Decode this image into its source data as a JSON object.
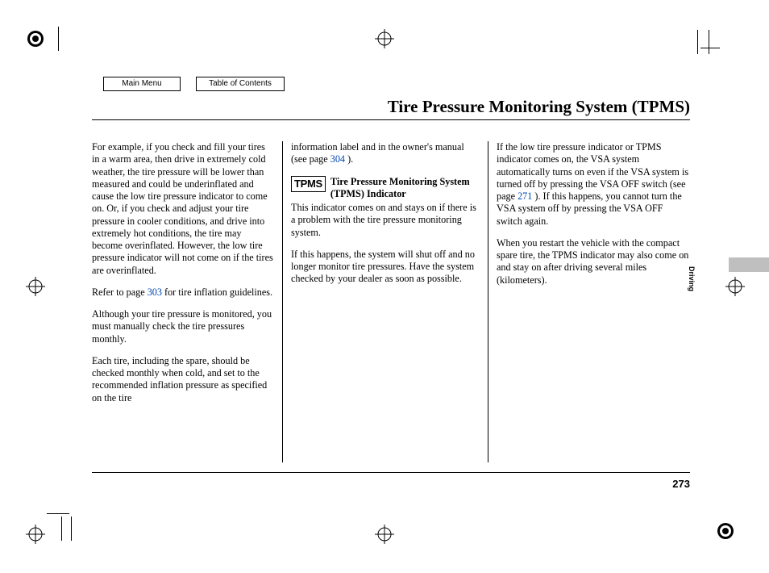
{
  "nav": {
    "main_menu": "Main Menu",
    "toc": "Table of Contents"
  },
  "title": "Tire Pressure Monitoring System (TPMS)",
  "section_tab": "Driving",
  "page_number": "273",
  "links": {
    "p303": "303",
    "p304": "304",
    "p271": "271"
  },
  "tpms_indicator": {
    "badge": "TPMS",
    "heading": "Tire Pressure Monitoring System (TPMS) Indicator"
  },
  "col1": {
    "p1": "For example, if you check and fill your tires in a warm area, then drive in extremely cold weather, the tire pressure will be lower than measured and could be underinflated and cause the low tire pressure indicator to come on. Or, if you check and adjust your tire pressure in cooler conditions, and drive into extremely hot conditions, the tire may become overinflated. However, the low tire pressure indicator will not come on if the tires are overinflated.",
    "p2a": "Refer to page ",
    "p2b": " for tire inflation guidelines.",
    "p3": "Although your tire pressure is monitored, you must manually check the tire pressures monthly.",
    "p4": "Each tire, including the spare, should be checked monthly when cold, and set to the recommended inflation pressure as specified on the tire"
  },
  "col2": {
    "p1a": "information label and in the owner's manual (see page ",
    "p1b": " ).",
    "p2": "This indicator comes on and stays on if there is a problem with the tire pressure monitoring system.",
    "p3": "If this happens, the system will shut off and no longer monitor tire pressures. Have the system checked by your dealer as soon as possible."
  },
  "col3": {
    "p1a": "If the low tire pressure indicator or TPMS indicator comes on, the VSA system automatically turns on even if the VSA system is turned off by pressing the VSA OFF switch (see page ",
    "p1b": " ). If this happens, you cannot turn the VSA system off by pressing the VSA OFF switch again.",
    "p2": "When you restart the vehicle with the compact spare tire, the TPMS indicator may also come on and stay on after driving several miles (kilometers)."
  }
}
